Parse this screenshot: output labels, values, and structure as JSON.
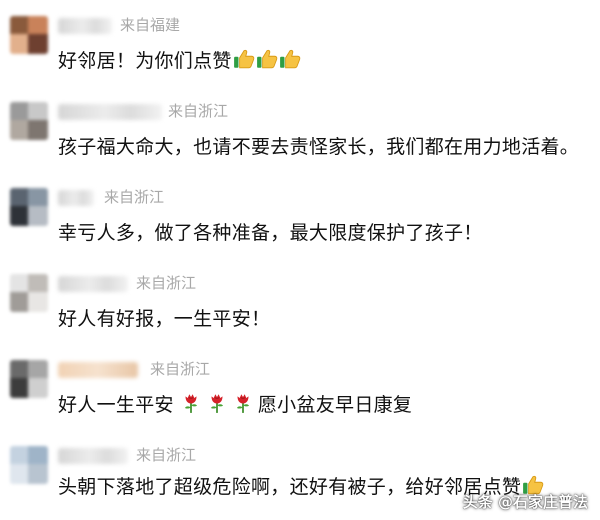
{
  "comments": [
    {
      "location": "来自福建",
      "text": "好邻居！为你们点赞",
      "emojis": [
        "thumbs-up-icon",
        "thumbs-up-icon",
        "thumbs-up-icon"
      ]
    },
    {
      "location": "来自浙江",
      "text": "孩子福大命大，也请不要去责怪家长，我们都在用力地活着。",
      "emojis": []
    },
    {
      "location": "来自浙江",
      "text": "幸亏人多，做了各种准备，最大限度保护了孩子！",
      "emojis": []
    },
    {
      "location": "来自浙江",
      "text": "好人有好报，一生平安！",
      "emojis": []
    },
    {
      "location": "来自浙江",
      "text": "好人一生平安",
      "text_after": "愿小盆友早日康复",
      "emojis": [
        "rose-icon",
        "rose-icon",
        "rose-icon"
      ]
    },
    {
      "location": "来自浙江",
      "text": "头朝下落地了超级危险啊，还好有被子，给好邻居点赞",
      "emojis": [
        "thumbs-up-icon"
      ]
    }
  ],
  "watermark": {
    "text": "头条 @石家庄普法"
  },
  "colors": {
    "location": "#a8a8a8",
    "text": "#111111",
    "background": "#ffffff"
  }
}
